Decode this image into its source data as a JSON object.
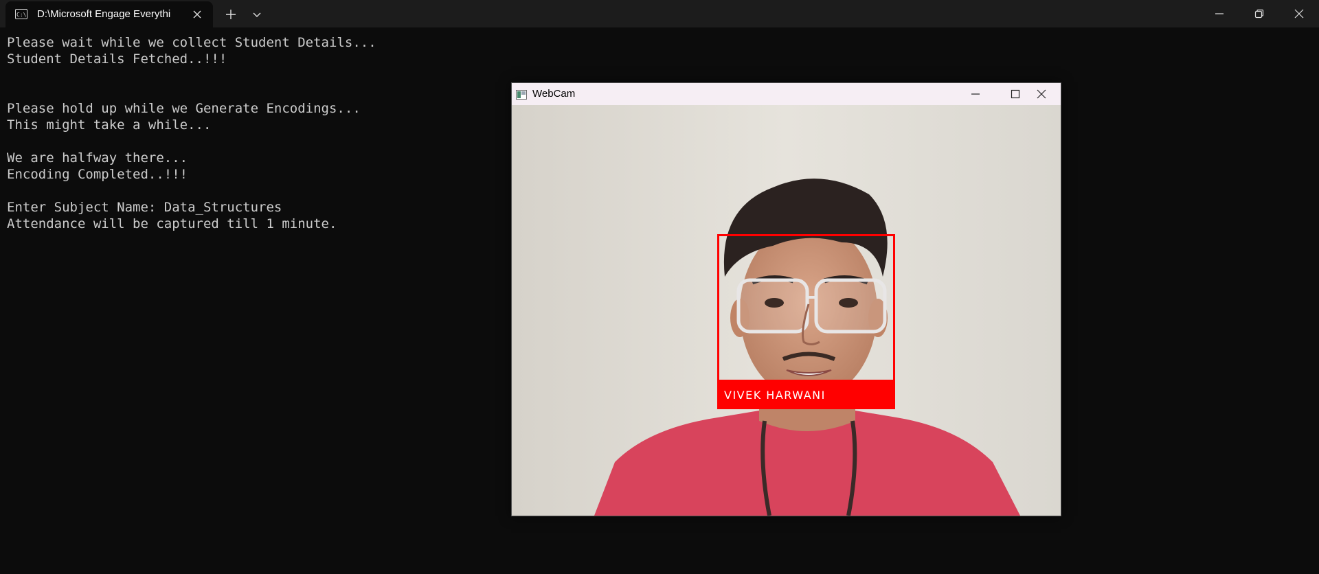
{
  "titlebar": {
    "tab_title": "D:\\Microsoft Engage Everythi",
    "tab_icon": "console-icon",
    "close_icon": "close-icon",
    "new_tab_icon": "plus-icon",
    "dropdown_icon": "chevron-down-icon"
  },
  "window_controls": {
    "minimize_icon": "minimize-icon",
    "restore_icon": "restore-icon",
    "close_icon": "close-icon"
  },
  "console": {
    "lines": [
      "Please wait while we collect Student Details...",
      "Student Details Fetched..!!!",
      "",
      "",
      "Please hold up while we Generate Encodings...",
      "This might take a while...",
      "",
      "We are halfway there...",
      "Encoding Completed..!!!",
      "",
      "Enter Subject Name: Data_Structures",
      "Attendance will be captured till 1 minute."
    ]
  },
  "webcam_window": {
    "title": "WebCam",
    "app_icon": "opencv-window-icon",
    "minimize_icon": "minimize-icon",
    "maximize_icon": "maximize-icon",
    "close_icon": "close-icon",
    "recognized_name": "VIVEK HARWANI",
    "box_color": "#ff0000"
  },
  "colors": {
    "terminal_bg": "#0c0c0c",
    "terminal_text": "#cccccc",
    "titlebar_bg": "#1c1c1c",
    "webcam_titlebar_bg": "#f6eef4"
  }
}
